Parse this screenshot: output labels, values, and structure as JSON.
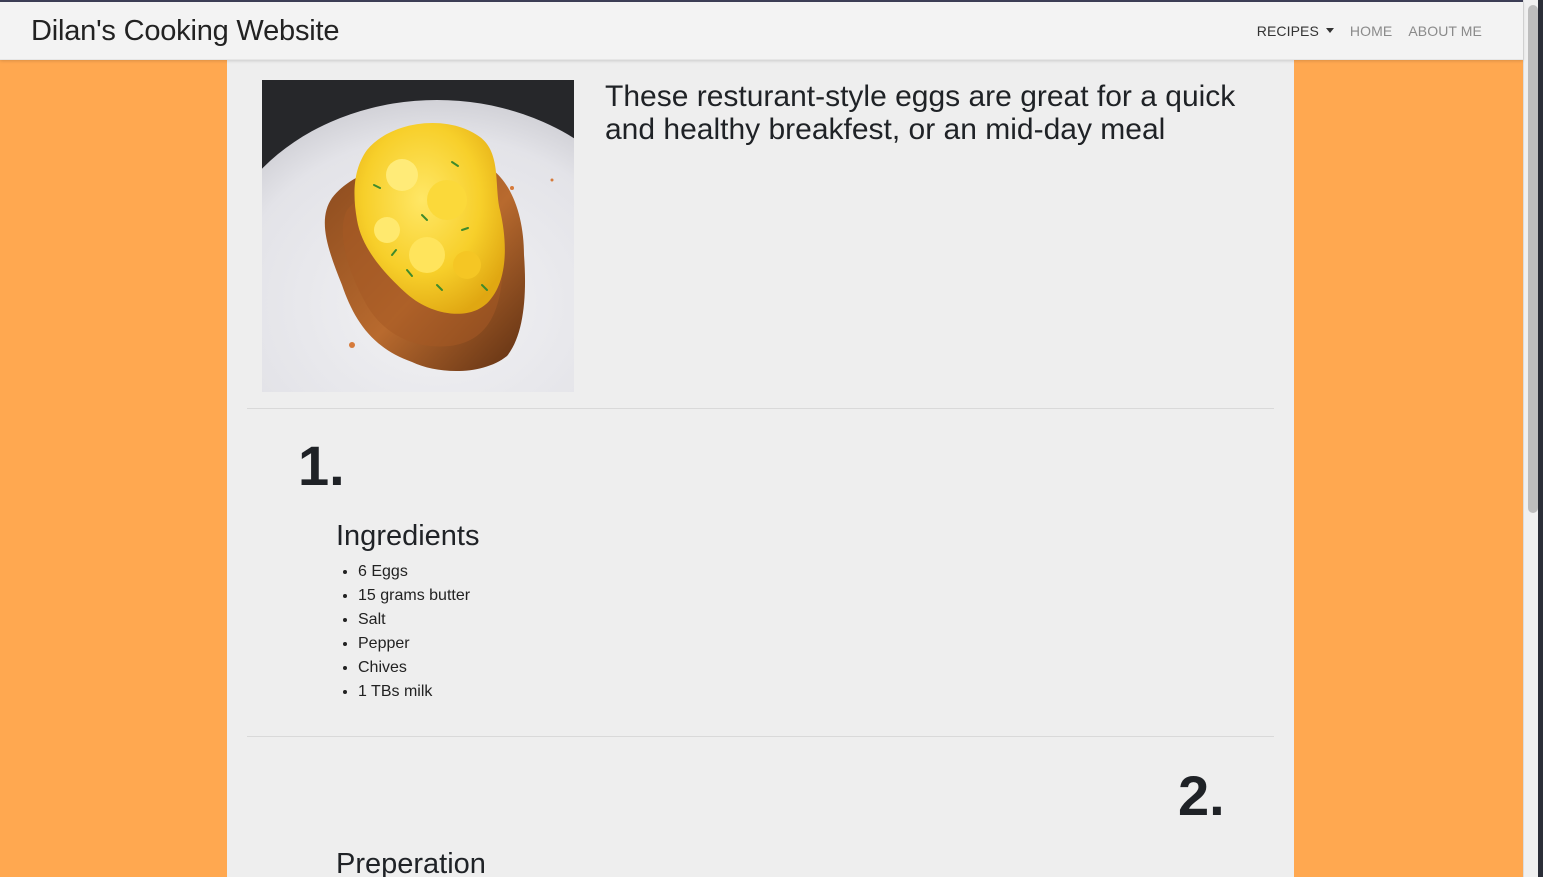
{
  "navbar": {
    "brand": "Dilan's Cooking Website",
    "links": [
      {
        "label": "RECIPES"
      },
      {
        "label": "HOME"
      },
      {
        "label": "ABOUT ME"
      }
    ]
  },
  "recipe": {
    "intro": "These resturant-style eggs are great for a quick and healthy breakfest, or an mid-day meal",
    "step1": {
      "number": "1.",
      "title": "Ingredients",
      "items": [
        "6 Eggs",
        "15 grams butter",
        "Salt",
        "Pepper",
        "Chives",
        "1 TBs milk"
      ]
    },
    "step2": {
      "number": "2.",
      "title": "Preperation"
    }
  },
  "colors": {
    "background": "#ffa850",
    "content": "#eeeeee",
    "navbar": "#f3f3f3"
  },
  "icons": {
    "dropdown": "caret-down-icon"
  }
}
